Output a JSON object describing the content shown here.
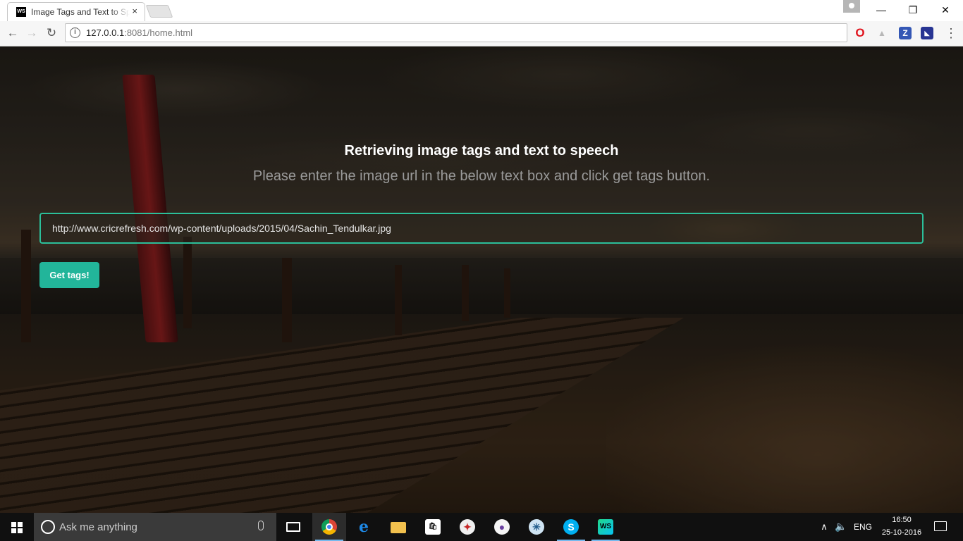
{
  "browser": {
    "tab_title": "Image Tags and Text to Speech",
    "favicon_label": "WS",
    "tab_close_glyph": "×",
    "url_host": "127.0.0.1",
    "url_path": ":8081/home.html",
    "controls": {
      "minimize": "—",
      "maximize": "❐",
      "close": "✕"
    },
    "nav": {
      "back": "←",
      "forward": "→",
      "reload": "↻"
    },
    "extensions": [
      {
        "name": "opera-icon",
        "glyph": "O"
      },
      {
        "name": "drive-icon",
        "glyph": "▲"
      },
      {
        "name": "z-extension-icon",
        "glyph": "Z"
      },
      {
        "name": "extension-icon",
        "glyph": "◣"
      }
    ],
    "menu_glyph": "⋮"
  },
  "page": {
    "heading": "Retrieving image tags and text to speech",
    "subheading": "Please enter the image url in the below text box and click get tags button.",
    "url_input_value": "http://www.cricrefresh.com/wp-content/uploads/2015/04/Sachin_Tendulkar.jpg",
    "button_label": "Get tags!",
    "accent_color": "#22b59a"
  },
  "taskbar": {
    "search_placeholder": "Ask me anything",
    "apps": [
      {
        "name": "task-view-icon",
        "glyph": ""
      },
      {
        "name": "chrome-icon",
        "glyph": ""
      },
      {
        "name": "edge-icon",
        "glyph": "e"
      },
      {
        "name": "file-explorer-icon",
        "glyph": ""
      },
      {
        "name": "store-icon",
        "glyph": "🛍"
      },
      {
        "name": "safari-icon",
        "glyph": "✦"
      },
      {
        "name": "github-icon",
        "glyph": "●"
      },
      {
        "name": "sourcetree-icon",
        "glyph": "✳"
      },
      {
        "name": "skype-icon",
        "glyph": "S"
      },
      {
        "name": "webstorm-icon",
        "glyph": "WS"
      }
    ],
    "tray": {
      "chevron": "∧",
      "volume": "🔈",
      "language": "ENG",
      "time": "16:50",
      "date": "25-10-2016"
    }
  }
}
